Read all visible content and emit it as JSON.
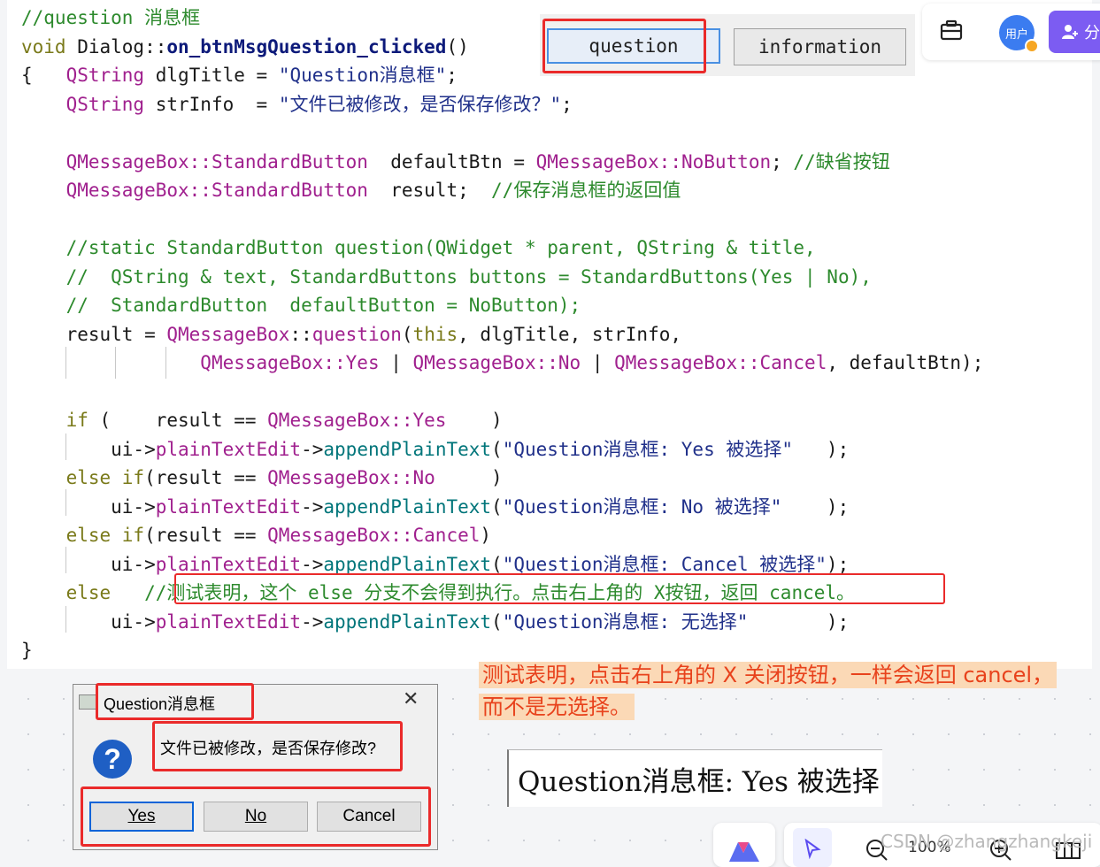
{
  "code": {
    "lines": [
      [
        {
          "t": "//question 消息框",
          "c": "c-cm"
        }
      ],
      [
        {
          "t": "void ",
          "c": "c-kw"
        },
        {
          "t": "Dialog",
          "c": "c-df"
        },
        {
          "t": "::",
          "c": "c-df"
        },
        {
          "t": "on_btnMsgQuestion_clicked",
          "c": "c-fn"
        },
        {
          "t": "()",
          "c": "c-df"
        }
      ],
      [
        {
          "t": "{   ",
          "c": "c-df"
        },
        {
          "t": "QString ",
          "c": "c-ty"
        },
        {
          "t": "dlgTitle = ",
          "c": "c-df"
        },
        {
          "t": "\"Question消息框\"",
          "c": "c-st"
        },
        {
          "t": ";",
          "c": "c-df"
        }
      ],
      [
        {
          "t": "    ",
          "c": "c-df"
        },
        {
          "t": "QString ",
          "c": "c-ty"
        },
        {
          "t": "strInfo  = ",
          "c": "c-df"
        },
        {
          "t": "\"文件已被修改，是否保存修改？\"",
          "c": "c-st"
        },
        {
          "t": ";",
          "c": "c-df"
        }
      ],
      [],
      [
        {
          "t": "    ",
          "c": "c-df"
        },
        {
          "t": "QMessageBox::StandardButton",
          "c": "c-ty"
        },
        {
          "t": "  defaultBtn = ",
          "c": "c-df"
        },
        {
          "t": "QMessageBox::NoButton",
          "c": "c-ty"
        },
        {
          "t": "; ",
          "c": "c-df"
        },
        {
          "t": "//缺省按钮",
          "c": "c-cm"
        }
      ],
      [
        {
          "t": "    ",
          "c": "c-df"
        },
        {
          "t": "QMessageBox::StandardButton",
          "c": "c-ty"
        },
        {
          "t": "  result;  ",
          "c": "c-df"
        },
        {
          "t": "//保存消息框的返回值",
          "c": "c-cm"
        }
      ],
      [],
      [
        {
          "t": "    //static StandardButton question(QWidget * parent, QString & title,",
          "c": "c-cm"
        }
      ],
      [
        {
          "t": "    //  QString & text, StandardButtons buttons = StandardButtons(Yes | No),",
          "c": "c-cm"
        }
      ],
      [
        {
          "t": "    //  StandardButton  defaultButton = NoButton);",
          "c": "c-cm"
        }
      ],
      [
        {
          "t": "    result = ",
          "c": "c-df"
        },
        {
          "t": "QMessageBox",
          "c": "c-ty"
        },
        {
          "t": "::",
          "c": "c-df"
        },
        {
          "t": "question",
          "c": "c-ty"
        },
        {
          "t": "(",
          "c": "c-df"
        },
        {
          "t": "this",
          "c": "c-kw"
        },
        {
          "t": ", dlgTitle, strInfo,",
          "c": "c-df"
        }
      ],
      [
        {
          "t": "                ",
          "c": "c-df"
        },
        {
          "t": "QMessageBox::Yes",
          "c": "c-ty"
        },
        {
          "t": " | ",
          "c": "c-df"
        },
        {
          "t": "QMessageBox::No",
          "c": "c-ty"
        },
        {
          "t": " | ",
          "c": "c-df"
        },
        {
          "t": "QMessageBox::Cancel",
          "c": "c-ty"
        },
        {
          "t": ", defaultBtn);",
          "c": "c-df"
        }
      ],
      [],
      [
        {
          "t": "    if",
          "c": "c-kw"
        },
        {
          "t": " (    result == ",
          "c": "c-df"
        },
        {
          "t": "QMessageBox::Yes",
          "c": "c-ty"
        },
        {
          "t": "    )",
          "c": "c-df"
        }
      ],
      [
        {
          "t": "        ui->",
          "c": "c-df"
        },
        {
          "t": "plainTextEdit",
          "c": "c-ty"
        },
        {
          "t": "->",
          "c": "c-df"
        },
        {
          "t": "appendPlainText",
          "c": "c-mt"
        },
        {
          "t": "(",
          "c": "c-df"
        },
        {
          "t": "\"Question消息框: Yes 被选择\"",
          "c": "c-st"
        },
        {
          "t": "   );",
          "c": "c-df"
        }
      ],
      [
        {
          "t": "    else if",
          "c": "c-kw"
        },
        {
          "t": "(result == ",
          "c": "c-df"
        },
        {
          "t": "QMessageBox::No",
          "c": "c-ty"
        },
        {
          "t": "     )",
          "c": "c-df"
        }
      ],
      [
        {
          "t": "        ui->",
          "c": "c-df"
        },
        {
          "t": "plainTextEdit",
          "c": "c-ty"
        },
        {
          "t": "->",
          "c": "c-df"
        },
        {
          "t": "appendPlainText",
          "c": "c-mt"
        },
        {
          "t": "(",
          "c": "c-df"
        },
        {
          "t": "\"Question消息框: No 被选择\"",
          "c": "c-st"
        },
        {
          "t": "    );",
          "c": "c-df"
        }
      ],
      [
        {
          "t": "    else if",
          "c": "c-kw"
        },
        {
          "t": "(result == ",
          "c": "c-df"
        },
        {
          "t": "QMessageBox::Cancel",
          "c": "c-ty"
        },
        {
          "t": ")",
          "c": "c-df"
        }
      ],
      [
        {
          "t": "        ui->",
          "c": "c-df"
        },
        {
          "t": "plainTextEdit",
          "c": "c-ty"
        },
        {
          "t": "->",
          "c": "c-df"
        },
        {
          "t": "appendPlainText",
          "c": "c-mt"
        },
        {
          "t": "(",
          "c": "c-df"
        },
        {
          "t": "\"Question消息框: Cancel 被选择\"",
          "c": "c-st"
        },
        {
          "t": ");",
          "c": "c-df"
        }
      ],
      [
        {
          "t": "    else",
          "c": "c-kw"
        },
        {
          "t": "   //测试表明，这个 else 分支不会得到执行。点击右上角的 X按钮，返回 cancel。",
          "c": "c-cm"
        }
      ],
      [
        {
          "t": "        ui->",
          "c": "c-df"
        },
        {
          "t": "plainTextEdit",
          "c": "c-ty"
        },
        {
          "t": "->",
          "c": "c-df"
        },
        {
          "t": "appendPlainText",
          "c": "c-mt"
        },
        {
          "t": "(",
          "c": "c-df"
        },
        {
          "t": "\"Question消息框: 无选择\"",
          "c": "c-st"
        },
        {
          "t": "       );",
          "c": "c-df"
        }
      ],
      [
        {
          "t": "}",
          "c": "c-df"
        }
      ]
    ]
  },
  "toolbar": {
    "question_label": "question",
    "information_label": "information"
  },
  "top_tools": {
    "avatar_label": "用户",
    "share_label": "分"
  },
  "annotation": {
    "line1": "测试表明，点击右上角的 X 关闭按钮，一样会返回 cancel，",
    "line2": "而不是无选择。"
  },
  "dialog": {
    "title": "Question消息框",
    "message": "文件已被修改，是否保存修改?",
    "icon_glyph": "?",
    "close_glyph": "✕",
    "buttons": [
      {
        "label": "Yes",
        "default": true
      },
      {
        "label": "No",
        "default": false
      },
      {
        "label": "Cancel",
        "default": false
      }
    ]
  },
  "result_text": "Question消息框: Yes 被选择",
  "bottom": {
    "zoom": "100%",
    "watermark": "CSDN @zhangzhangkeji"
  },
  "colors": {
    "highlight_red": "#ea2a2a",
    "note_text": "#e8421c",
    "note_bg": "#fbd9b6",
    "share_bg": "#7c5cf2",
    "avatar_bg": "#3b7cf0",
    "dialog_icon": "#1f5fc4"
  }
}
